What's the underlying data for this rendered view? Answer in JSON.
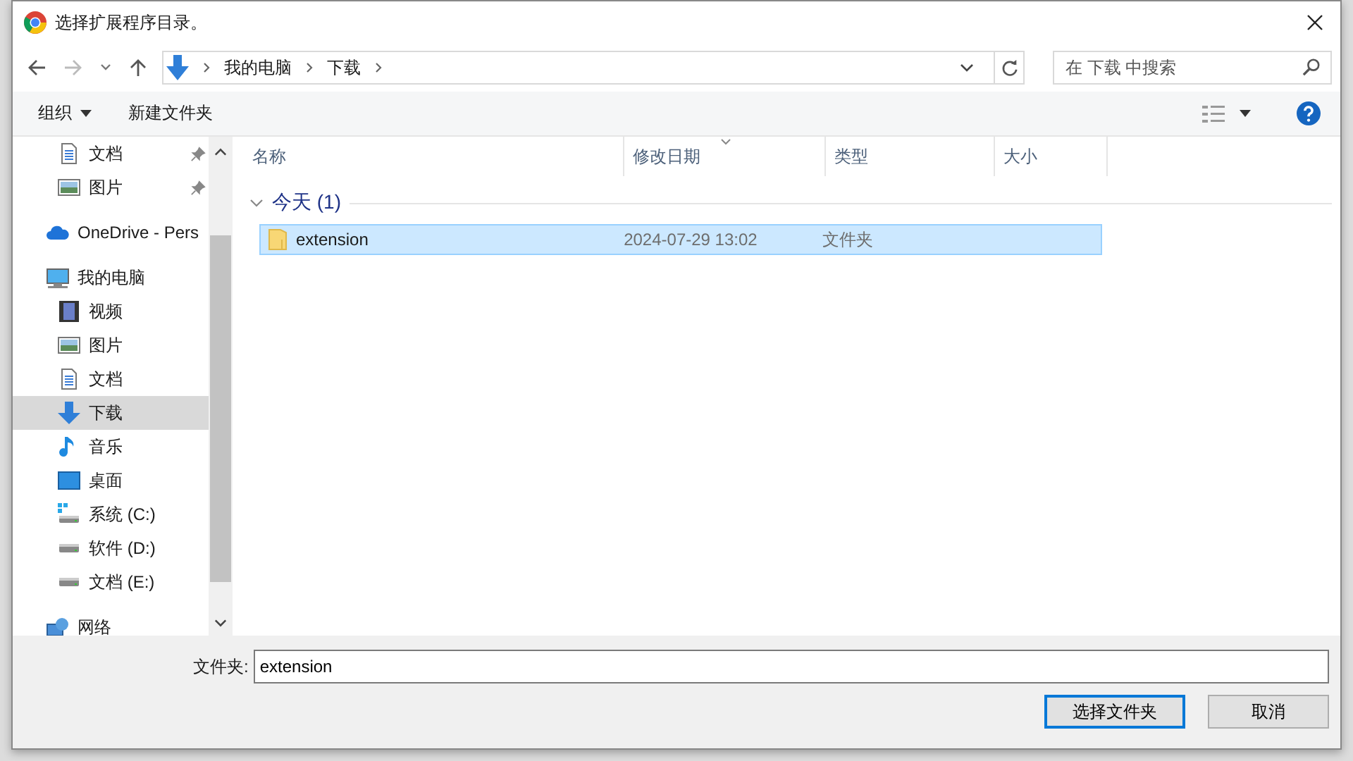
{
  "window": {
    "title": "选择扩展程序目录。"
  },
  "address_bar": {
    "path": [
      "我的电脑",
      "下载"
    ]
  },
  "search": {
    "placeholder": "在 下载 中搜索"
  },
  "toolbar": {
    "organize": "组织",
    "new_folder": "新建文件夹"
  },
  "sidebar": {
    "pinned_items": [
      {
        "label": "文档",
        "kind": "document"
      },
      {
        "label": "图片",
        "kind": "picture"
      }
    ],
    "items": [
      {
        "label": "OneDrive - Pers",
        "kind": "cloud",
        "selected": false
      },
      {
        "label": "我的电脑",
        "kind": "computer",
        "selected": false,
        "children": [
          {
            "label": "视频",
            "kind": "video",
            "selected": false
          },
          {
            "label": "图片",
            "kind": "picture",
            "selected": false
          },
          {
            "label": "文档",
            "kind": "document",
            "selected": false
          },
          {
            "label": "下载",
            "kind": "download",
            "selected": true
          },
          {
            "label": "音乐",
            "kind": "music",
            "selected": false
          },
          {
            "label": "桌面",
            "kind": "desktop",
            "selected": false
          },
          {
            "label": "系统 (C:)",
            "kind": "system-drive",
            "selected": false
          },
          {
            "label": "软件 (D:)",
            "kind": "drive",
            "selected": false
          },
          {
            "label": "文档 (E:)",
            "kind": "drive",
            "selected": false
          }
        ]
      },
      {
        "label": "网络",
        "kind": "network",
        "selected": false
      }
    ]
  },
  "columns": [
    {
      "label": "名称",
      "sorted": false
    },
    {
      "label": "修改日期",
      "sorted": true
    },
    {
      "label": "类型",
      "sorted": false
    },
    {
      "label": "大小",
      "sorted": false
    }
  ],
  "groups": [
    {
      "title": "今天 (1)",
      "expanded": true,
      "rows": [
        {
          "name": "extension",
          "modified": "2024-07-29 13:02",
          "type": "文件夹",
          "selected": true
        }
      ]
    }
  ],
  "folder_field": {
    "label": "文件夹:",
    "value": "extension"
  },
  "buttons": [
    {
      "label": "选择文件夹",
      "kind": "primary"
    },
    {
      "label": "取消",
      "kind": "secondary"
    }
  ]
}
